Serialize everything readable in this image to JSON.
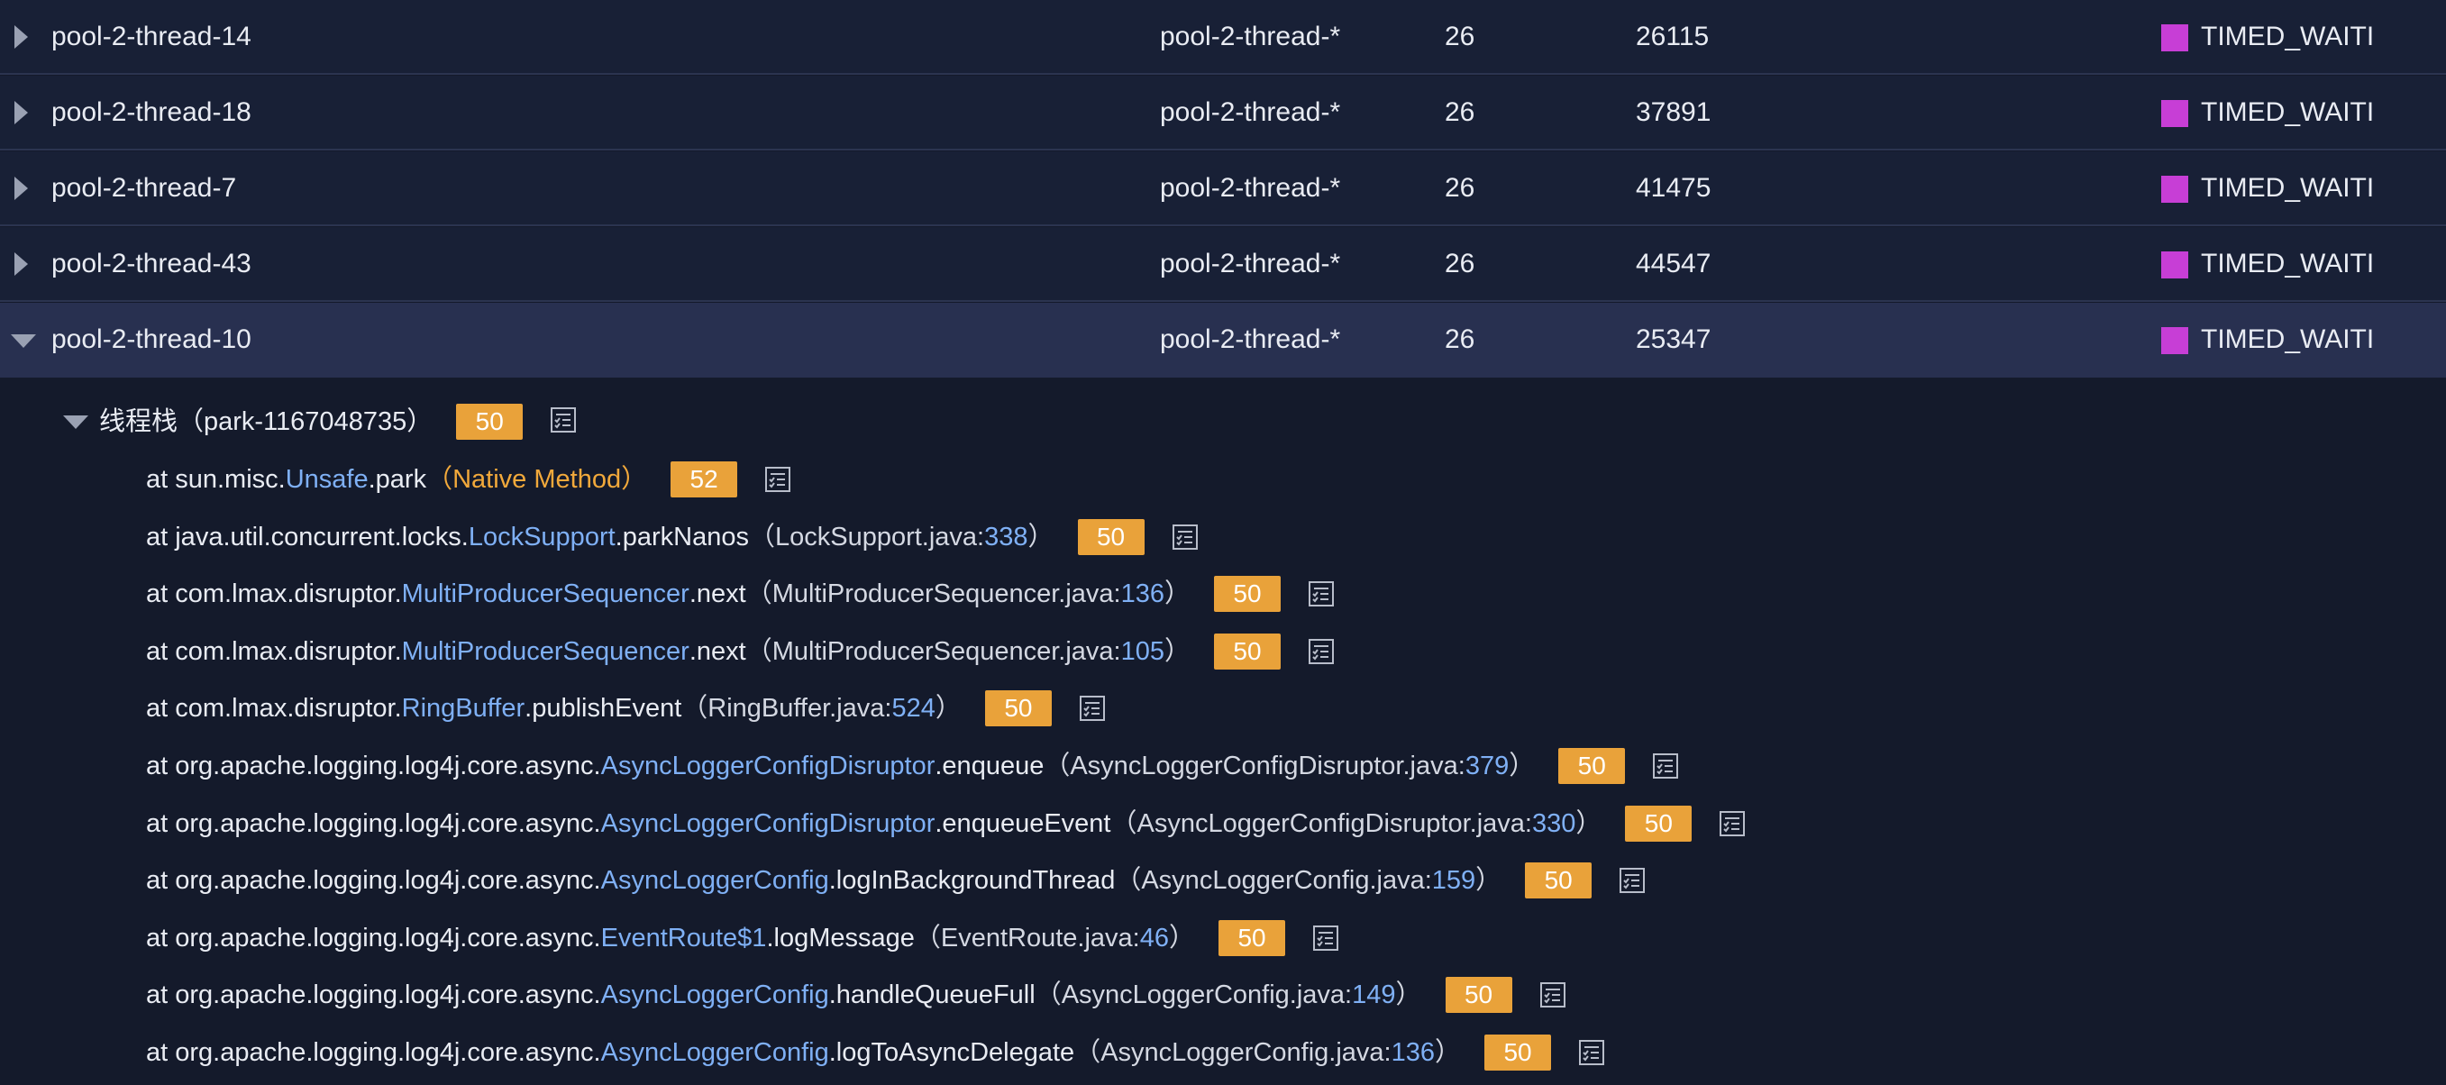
{
  "threads": [
    {
      "name": "pool-2-thread-14",
      "group": "pool-2-thread-*",
      "priority": "26",
      "id": "26115",
      "state": "TIMED_WAITI",
      "expanded": false
    },
    {
      "name": "pool-2-thread-18",
      "group": "pool-2-thread-*",
      "priority": "26",
      "id": "37891",
      "state": "TIMED_WAITI",
      "expanded": false
    },
    {
      "name": "pool-2-thread-7",
      "group": "pool-2-thread-*",
      "priority": "26",
      "id": "41475",
      "state": "TIMED_WAITI",
      "expanded": false
    },
    {
      "name": "pool-2-thread-43",
      "group": "pool-2-thread-*",
      "priority": "26",
      "id": "44547",
      "state": "TIMED_WAITI",
      "expanded": false
    },
    {
      "name": "pool-2-thread-10",
      "group": "pool-2-thread-*",
      "priority": "26",
      "id": "25347",
      "state": "TIMED_WAITI",
      "expanded": true
    }
  ],
  "colors": {
    "state_timed_waiting": "#c73ed6",
    "badge": "#e9a23a",
    "class_link": "#7fb0f5",
    "native": "#f2a93b"
  },
  "stack": {
    "title": "线程栈（park-1167048735）",
    "count": "50",
    "icon": "list-check-icon",
    "frames": [
      {
        "prefix": "at sun.misc.",
        "cls": "Unsafe",
        "method": ".park",
        "src_open": "（Native Method）",
        "line": "",
        "src_close": "",
        "count": "52",
        "native": true
      },
      {
        "prefix": "at java.util.concurrent.locks.",
        "cls": "LockSupport",
        "method": ".parkNanos",
        "src_open": "（LockSupport.java:",
        "line": "338",
        "src_close": " ）",
        "count": "50",
        "native": false
      },
      {
        "prefix": "at com.lmax.disruptor.",
        "cls": "MultiProducerSequencer",
        "method": ".next",
        "src_open": "（MultiProducerSequencer.java:",
        "line": "136",
        "src_close": " ）",
        "count": "50",
        "native": false
      },
      {
        "prefix": "at com.lmax.disruptor.",
        "cls": "MultiProducerSequencer",
        "method": ".next",
        "src_open": "（MultiProducerSequencer.java:",
        "line": "105",
        "src_close": " ）",
        "count": "50",
        "native": false
      },
      {
        "prefix": "at com.lmax.disruptor.",
        "cls": "RingBuffer",
        "method": ".publishEvent",
        "src_open": "（RingBuffer.java:",
        "line": "524",
        "src_close": " ）",
        "count": "50",
        "native": false
      },
      {
        "prefix": "at org.apache.logging.log4j.core.async.",
        "cls": "AsyncLoggerConfigDisruptor",
        "method": ".enqueue",
        "src_open": "（AsyncLoggerConfigDisruptor.java:",
        "line": "379",
        "src_close": " ）",
        "count": "50",
        "native": false
      },
      {
        "prefix": "at org.apache.logging.log4j.core.async.",
        "cls": "AsyncLoggerConfigDisruptor",
        "method": ".enqueueEvent",
        "src_open": "（AsyncLoggerConfigDisruptor.java:",
        "line": "330",
        "src_close": " ）",
        "count": "50",
        "native": false
      },
      {
        "prefix": "at org.apache.logging.log4j.core.async.",
        "cls": "AsyncLoggerConfig",
        "method": ".logInBackgroundThread",
        "src_open": "（AsyncLoggerConfig.java:",
        "line": "159",
        "src_close": " ）",
        "count": "50",
        "native": false
      },
      {
        "prefix": "at org.apache.logging.log4j.core.async.",
        "cls": "EventRoute$1",
        "method": ".logMessage",
        "src_open": "（EventRoute.java:",
        "line": "46",
        "src_close": " ）",
        "count": "50",
        "native": false
      },
      {
        "prefix": "at org.apache.logging.log4j.core.async.",
        "cls": "AsyncLoggerConfig",
        "method": ".handleQueueFull",
        "src_open": "（AsyncLoggerConfig.java:",
        "line": "149",
        "src_close": " ）",
        "count": "50",
        "native": false
      },
      {
        "prefix": "at org.apache.logging.log4j.core.async.",
        "cls": "AsyncLoggerConfig",
        "method": ".logToAsyncDelegate",
        "src_open": "（AsyncLoggerConfig.java:",
        "line": "136",
        "src_close": " ）",
        "count": "50",
        "native": false
      }
    ]
  }
}
